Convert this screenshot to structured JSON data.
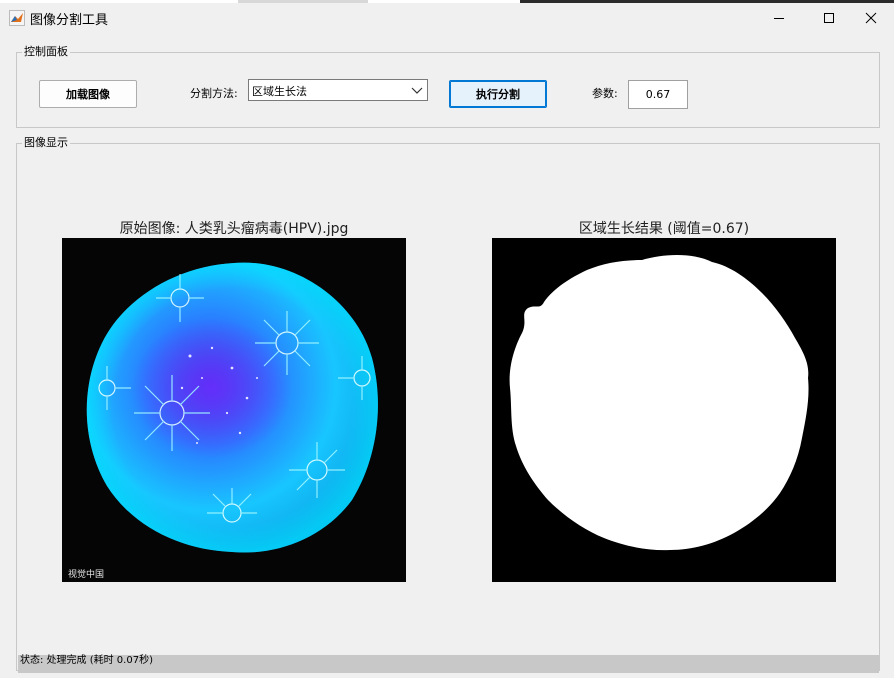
{
  "window": {
    "title": "图像分割工具",
    "icon": "matlab-icon"
  },
  "control_panel": {
    "legend": "控制面板",
    "load_button": "加载图像",
    "method_label": "分割方法:",
    "method_value": "区域生长法",
    "run_button": "执行分割",
    "param_label": "参数:",
    "param_value": "0.67"
  },
  "display_panel": {
    "legend": "图像显示",
    "left_title": "原始图像: 人类乳头瘤病毒(HPV).jpg",
    "left_watermark": "视觉中国",
    "right_title": "区域生长结果 (阈值=0.67)"
  },
  "status": {
    "text": "状态: 处理完成 (耗时 0.07秒)"
  },
  "colors": {
    "segment_fg": "#ffffff",
    "segment_bg": "#000000",
    "virus_cyan": "#1ee3ff",
    "virus_blue": "#2a6bff"
  }
}
